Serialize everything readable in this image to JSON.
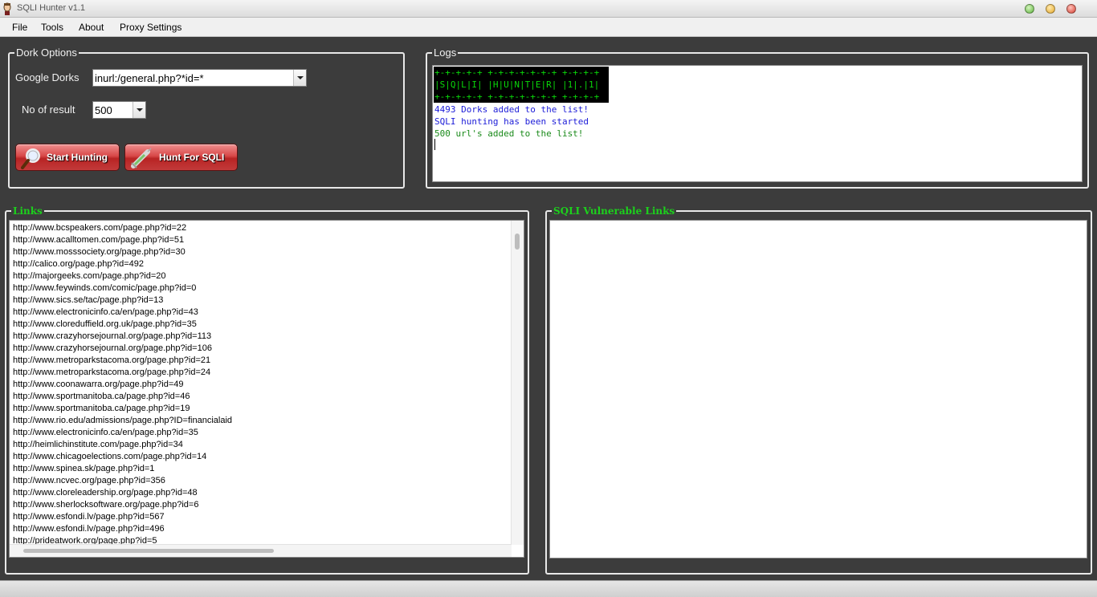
{
  "window": {
    "title": "SQLI Hunter v1.1"
  },
  "menu": [
    "File",
    "Tools",
    "About",
    "Proxy Settings"
  ],
  "dork_options": {
    "title": "Dork Options",
    "google_dorks_label": "Google Dorks",
    "google_dorks_value": "inurl:/general.php?*id=*",
    "results_label": "No of result",
    "results_value": "500",
    "start_button": "Start Hunting",
    "hunt_button": "Hunt For SQLI"
  },
  "logs": {
    "title": "Logs",
    "banner": "+-+-+-+-+ +-+-+-+-+-+-+ +-+-+-+\n|S|Q|L|I| |H|U|N|T|E|R| |1|.|1|\n+-+-+-+-+ +-+-+-+-+-+-+ +-+-+-+",
    "lines": [
      {
        "text": "4493 Dorks added to the list!",
        "color": "#1c1cd8"
      },
      {
        "text": "SQLI hunting has been started",
        "color": "#1c1cd8"
      },
      {
        "text": "500 url's added to the list!",
        "color": "#1a8a1a"
      }
    ]
  },
  "links": {
    "title": "Links",
    "items": [
      "http://www.bcspeakers.com/page.php?id=22",
      "http://www.acalltomen.com/page.php?id=51",
      "http://www.mosssociety.org/page.php?id=30",
      "http://calico.org/page.php?id=492",
      "http://majorgeeks.com/page.php?id=20",
      "http://www.feywinds.com/comic/page.php?id=0",
      "http://www.sics.se/tac/page.php?id=13",
      "http://www.electronicinfo.ca/en/page.php?id=43",
      "http://www.cloreduffield.org.uk/page.php?id=35",
      "http://www.crazyhorsejournal.org/page.php?id=113",
      "http://www.crazyhorsejournal.org/page.php?id=106",
      "http://www.metroparkstacoma.org/page.php?id=21",
      "http://www.metroparkstacoma.org/page.php?id=24",
      "http://www.coonawarra.org/page.php?id=49",
      "http://www.sportmanitoba.ca/page.php?id=46",
      "http://www.sportmanitoba.ca/page.php?id=19",
      "http://www.rio.edu/admissions/page.php?ID=financialaid",
      "http://www.electronicinfo.ca/en/page.php?id=35",
      "http://heimlichinstitute.com/page.php?id=34",
      "http://www.chicagoelections.com/page.php?id=14",
      "http://www.spinea.sk/page.php?id=1",
      "http://www.ncvec.org/page.php?id=356",
      "http://www.cloreleadership.org/page.php?id=48",
      "http://www.sherlocksoftware.org/page.php?id=6",
      "http://www.esfondi.lv/page.php?id=567",
      "http://www.esfondi.lv/page.php?id=496",
      "http://prideatwork.org/page.php?id=5"
    ]
  },
  "vulnerable": {
    "title": "SQLI Vulnerable Links",
    "items": []
  },
  "colors": {
    "background": "#3c3c3c",
    "section_title_green": "#1cd11c",
    "button_red": "#c23a3a"
  }
}
